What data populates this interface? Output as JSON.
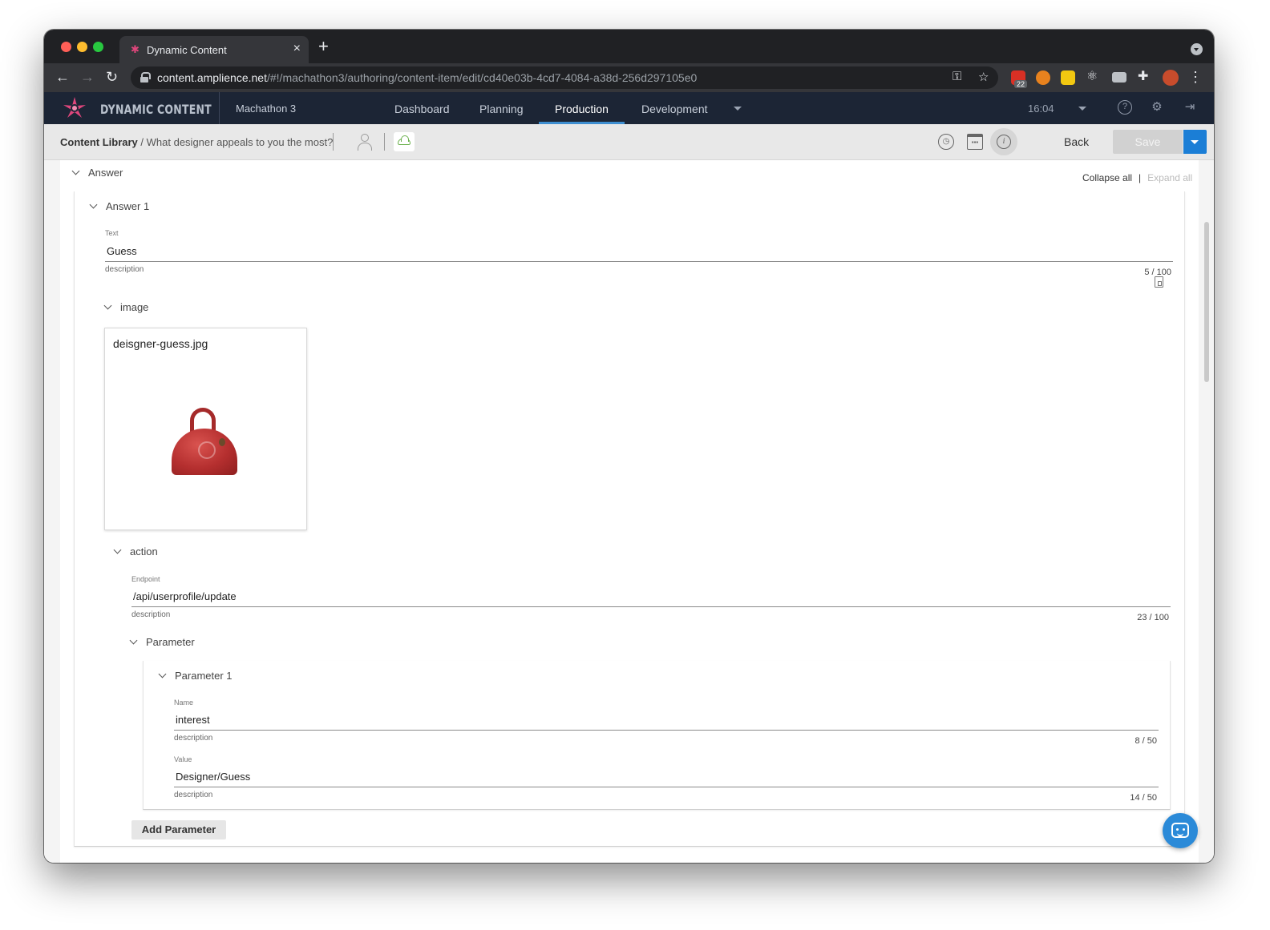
{
  "browser": {
    "tab_title": "Dynamic Content",
    "url_host": "content.amplience.net",
    "url_path": "/#!/machathon3/authoring/content-item/edit/cd40e03b-4cd7-4084-a38d-256d297105e0",
    "extension_badge": "22"
  },
  "app": {
    "logo_text": "DYNAMIC CONTENT",
    "hub_name": "Machathon 3",
    "nav": [
      "Dashboard",
      "Planning",
      "Production",
      "Development"
    ],
    "active_nav": "Production",
    "time": "16:04"
  },
  "subheader": {
    "breadcrumb_root": "Content Library",
    "breadcrumb_current": "/ What designer appeals to you the most?",
    "back_label": "Back",
    "save_label": "Save"
  },
  "editor": {
    "section_answer": "Answer",
    "collapse_all": "Collapse all",
    "separator": "|",
    "expand_all": "Expand all",
    "answer_item": "Answer 1",
    "text_field": {
      "label": "Text",
      "value": "Guess",
      "description": "description",
      "count": "5 / 100"
    },
    "image_section": "image",
    "image_name": "deisgner-guess.jpg",
    "action_section": "action",
    "endpoint_field": {
      "label": "Endpoint",
      "value": "/api/userprofile/update",
      "description": "description",
      "count": "23 / 100"
    },
    "parameter_section": "Parameter",
    "parameter_item": "Parameter 1",
    "name_field": {
      "label": "Name",
      "value": "interest",
      "description": "description",
      "count": "8 / 50"
    },
    "value_field": {
      "label": "Value",
      "value": "Designer/Guess",
      "description": "description",
      "count": "14 / 50"
    },
    "add_parameter_label": "Add Parameter"
  },
  "colors": {
    "accent": "#1b7ed6",
    "header_bg": "#1c2535",
    "active_tab_bar": "#3e8ed0",
    "logo_pink": "#e0467c",
    "cloud_green": "#6ab04c"
  }
}
